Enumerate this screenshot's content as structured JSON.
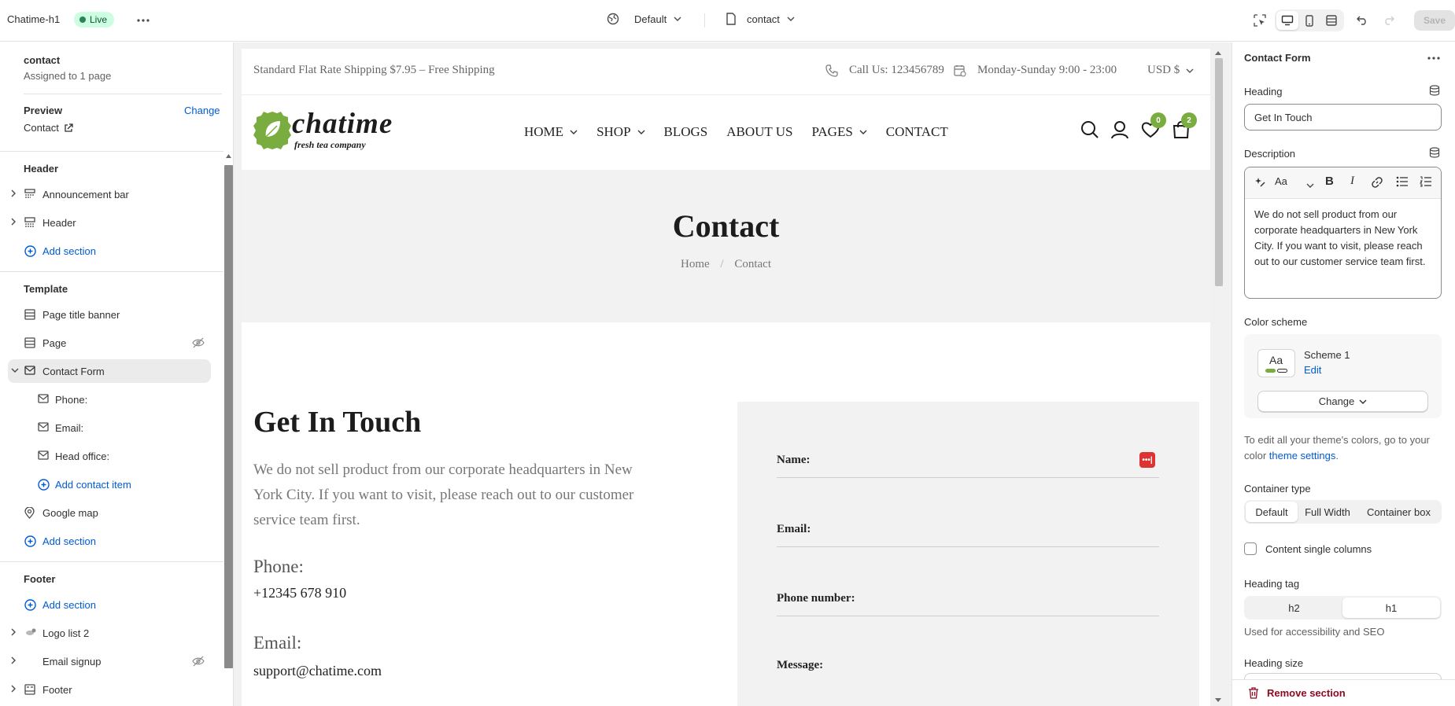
{
  "topbar": {
    "store_name": "Chatime-h1",
    "live_label": "Live",
    "theme_label": "Default",
    "page_label": "contact",
    "save_label": "Save"
  },
  "left": {
    "title": "contact",
    "assigned": "Assigned to 1 page",
    "preview_label": "Preview",
    "change_label": "Change",
    "preview_value": "Contact",
    "header_group": "Header",
    "header_items": [
      "Announcement bar",
      "Header"
    ],
    "add_section": "Add section",
    "template_group": "Template",
    "template_items": [
      "Page title banner",
      "Page",
      "Contact Form"
    ],
    "contact_items": [
      "Phone:",
      "Email:",
      "Head office:"
    ],
    "add_contact_item": "Add contact item",
    "google_map": "Google map",
    "footer_group": "Footer",
    "footer_items": [
      "Logo list 2",
      "Email signup",
      "Footer"
    ]
  },
  "preview": {
    "announcement": "Standard Flat Rate Shipping $7.95 – Free Shipping",
    "call": "Call Us: 123456789",
    "hours": "Monday-Sunday 9:00 - 23:00",
    "currency": "USD $",
    "logo_main": "chatime",
    "logo_sub": "fresh tea company",
    "nav": [
      "HOME",
      "SHOP",
      "BLOGS",
      "ABOUT US",
      "PAGES",
      "CONTACT"
    ],
    "wishlist_count": "0",
    "cart_count": "2",
    "banner_title": "Contact",
    "crumb_home": "Home",
    "crumb_sep": "/",
    "crumb_current": "Contact",
    "heading": "Get In Touch",
    "description": "We do not sell product from our corporate headquarters in New York City. If you want to visit, please reach out to our customer service team first.",
    "phone_label": "Phone:",
    "phone_value": "+12345 678 910",
    "email_label": "Email:",
    "email_value": "support@chatime.com",
    "form": {
      "name_label": "Name:",
      "email_label": "Email:",
      "phone_label": "Phone number:",
      "message_label": "Message:"
    }
  },
  "right": {
    "title": "Contact Form",
    "heading_label": "Heading",
    "heading_value": "Get In Touch",
    "description_label": "Description",
    "description_value": "We do not sell product from our corporate headquarters in New York City. If you want to visit, please reach out to our customer service team first.",
    "color_scheme_label": "Color scheme",
    "scheme_name": "Scheme 1",
    "scheme_edit": "Edit",
    "scheme_change": "Change",
    "help_prefix": "To edit all your theme's colors, go to your color ",
    "help_link": "theme settings",
    "help_suffix": ".",
    "container_type_label": "Container type",
    "container_options": [
      "Default",
      "Full Width",
      "Container box"
    ],
    "single_columns_label": "Content single columns",
    "heading_tag_label": "Heading tag",
    "heading_tag_options": [
      "h2",
      "h1"
    ],
    "heading_tag_help": "Used for accessibility and SEO",
    "heading_size_label": "Heading size",
    "remove_section": "Remove section"
  },
  "colors": {
    "accent": "#005bd3",
    "live_bg": "#cdfee1",
    "brand_green": "#7aad3f",
    "danger": "#8e0b21"
  },
  "icons": {
    "seg_devices": [
      "inspector-icon",
      "desktop-icon",
      "mobile-icon",
      "fullwidth-icon"
    ]
  }
}
